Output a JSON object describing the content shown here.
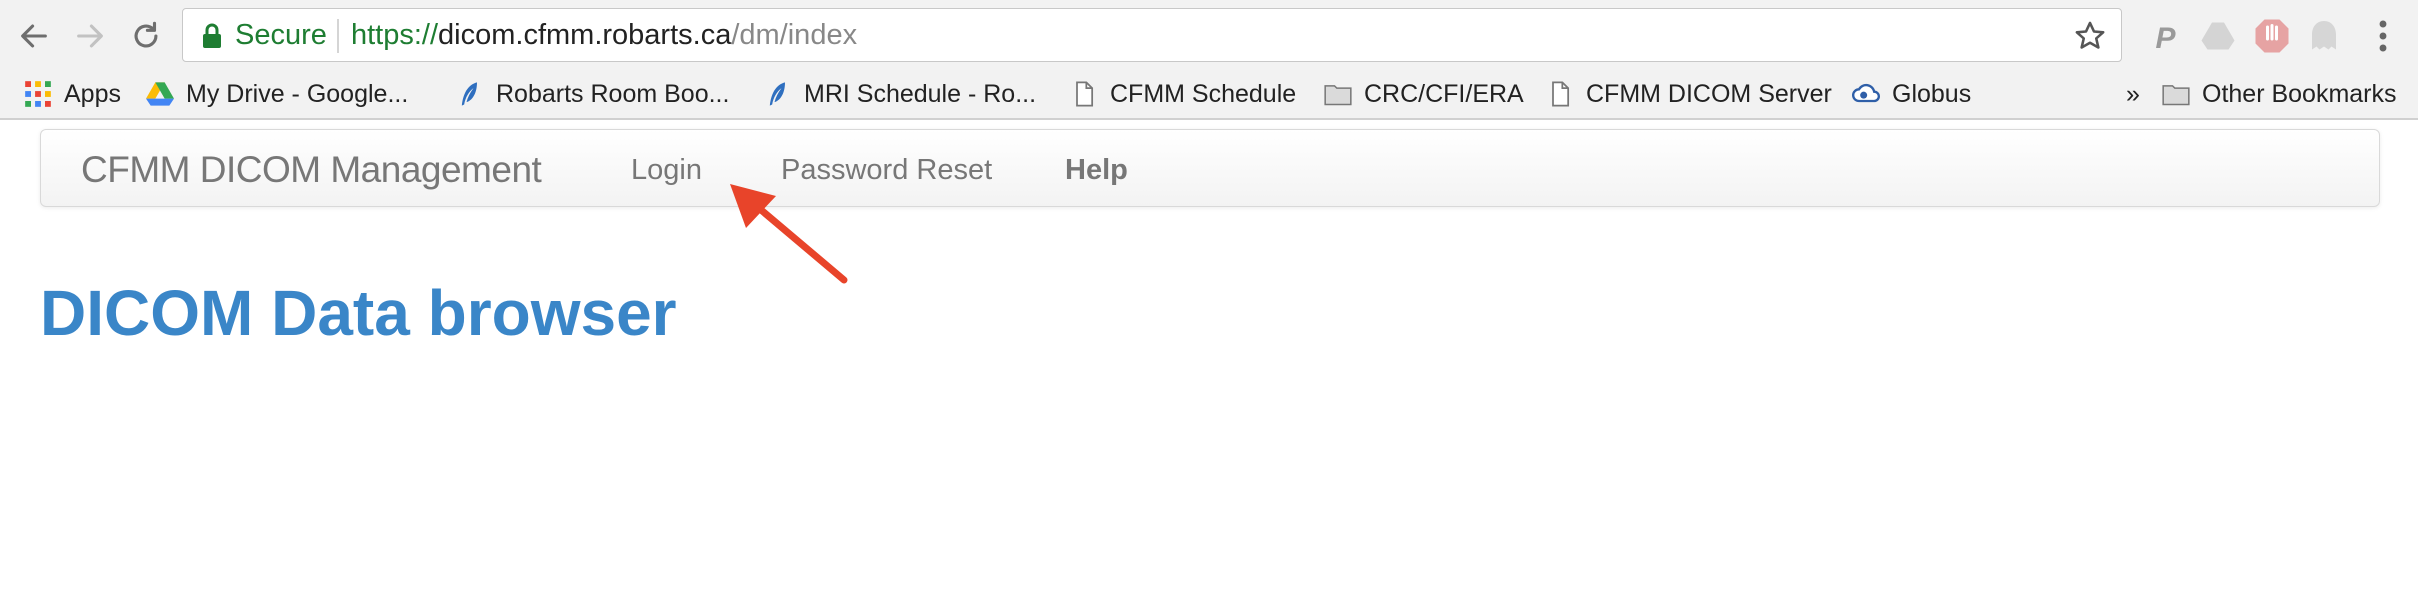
{
  "browser": {
    "security_label": "Secure",
    "url": {
      "scheme": "https://",
      "host": "dicom.cfmm.robarts.ca",
      "path": "/dm/index"
    },
    "extensions": [
      "paypal-icon",
      "drive-icon",
      "adblock-icon",
      "ghostery-icon"
    ]
  },
  "bookmarks": {
    "items": [
      {
        "label": "Apps",
        "icon": "apps-grid-icon"
      },
      {
        "label": "My Drive - Google...",
        "icon": "google-drive-icon"
      },
      {
        "label": "Robarts Room Boo...",
        "icon": "feather-icon"
      },
      {
        "label": "MRI Schedule - Ro...",
        "icon": "feather-icon"
      },
      {
        "label": "CFMM Schedule",
        "icon": "page-icon"
      },
      {
        "label": "CRC/CFI/ERA",
        "icon": "folder-icon"
      },
      {
        "label": "CFMM DICOM Server",
        "icon": "page-icon"
      },
      {
        "label": "Globus",
        "icon": "globus-icon"
      }
    ],
    "overflow": "»",
    "other": "Other Bookmarks"
  },
  "navbar": {
    "brand": "CFMM DICOM Management",
    "links": [
      "Login",
      "Password Reset",
      "Help"
    ]
  },
  "page": {
    "title": "DICOM Data browser"
  },
  "colors": {
    "title": "#3a86c8",
    "secure": "#1e7d32",
    "annotation_arrow": "#e8442a"
  }
}
